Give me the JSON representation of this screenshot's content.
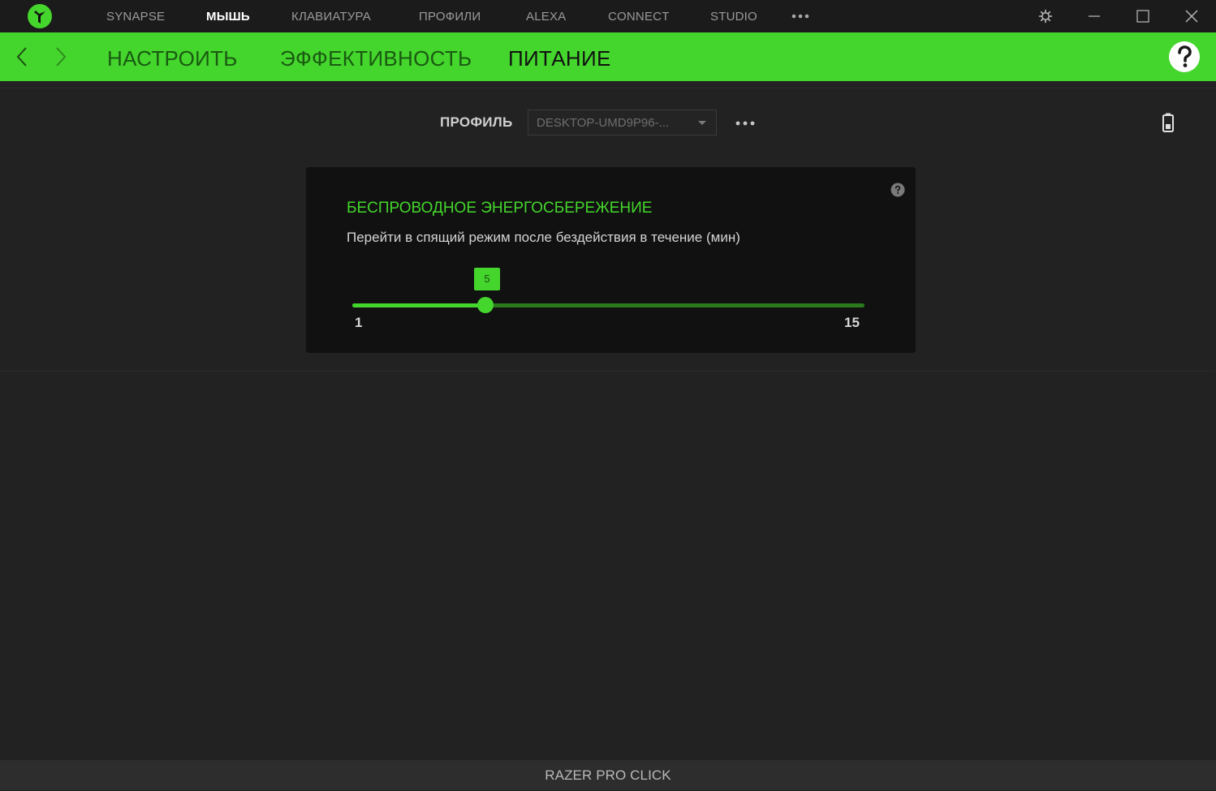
{
  "titlebar": {
    "nav": [
      {
        "label": "SYNAPSE",
        "active": false
      },
      {
        "label": "МЫШЬ",
        "active": true
      },
      {
        "label": "КЛАВИАТУРА",
        "active": false
      },
      {
        "label": "ПРОФИЛИ",
        "active": false
      },
      {
        "label": "ALEXA",
        "active": false
      },
      {
        "label": "CONNECT",
        "active": false
      },
      {
        "label": "STUDIO",
        "active": false
      }
    ],
    "more_icon": "more-dots-icon",
    "settings_icon": "gear-icon",
    "minimize_icon": "minimize-icon",
    "maximize_icon": "maximize-icon",
    "close_icon": "close-icon"
  },
  "subnav": {
    "tabs": [
      {
        "label": "НАСТРОИТЬ",
        "active": false
      },
      {
        "label": "ЭФФЕКТИВНОСТЬ",
        "active": false
      },
      {
        "label": "ПИТАНИЕ",
        "active": true
      }
    ],
    "back_icon": "chevron-left-icon",
    "forward_icon": "chevron-right-icon",
    "help_icon": "help-icon"
  },
  "profile": {
    "label": "ПРОФИЛЬ",
    "selected": "DESKTOP-UMD9P96-...",
    "more_icon": "more-dots-icon",
    "battery_icon": "battery-icon"
  },
  "power_card": {
    "title": "БЕСПРОВОДНОЕ ЭНЕРГОСБЕРЕЖЕНИЕ",
    "description": "Перейти в спящий режим после бездействия в течение (мин)",
    "help_icon": "help-icon",
    "slider": {
      "min": 1,
      "max": 15,
      "value": 5,
      "min_label": "1",
      "max_label": "15",
      "value_label": "5"
    }
  },
  "footer": {
    "device_name": "RAZER PRO CLICK"
  },
  "colors": {
    "accent": "#44d62c",
    "titlebar_bg": "#1b1b1b",
    "content_bg": "#222222",
    "card_bg": "#111111"
  }
}
